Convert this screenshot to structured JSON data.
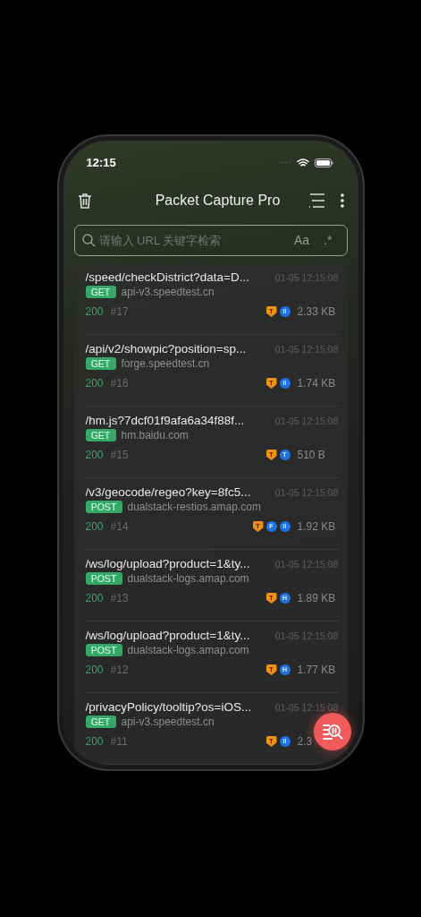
{
  "status_bar": {
    "time": "12:15"
  },
  "header": {
    "title": "Packet Capture Pro"
  },
  "search": {
    "placeholder": "请输入 URL 关键字检索",
    "case_toggle": "Aa",
    "regex_toggle": ".*"
  },
  "requests": [
    {
      "path": "/speed/checkDistrict?data=D...",
      "time": "01-05 12:15:08",
      "method": "GET",
      "host": "api-v3.speedtest.cn",
      "status": "200",
      "index": "#17",
      "tags": [
        {
          "kind": "shield",
          "label": "T"
        },
        {
          "kind": "circle",
          "label": "II"
        }
      ],
      "size": "2.33 KB"
    },
    {
      "path": "/api/v2/showpic?position=sp...",
      "time": "01-05 12:15:08",
      "method": "GET",
      "host": "forge.speedtest.cn",
      "status": "200",
      "index": "#16",
      "tags": [
        {
          "kind": "shield",
          "label": "T"
        },
        {
          "kind": "circle",
          "label": "II"
        }
      ],
      "size": "1.74 KB"
    },
    {
      "path": "/hm.js?7dcf01f9afa6a34f88f...",
      "time": "01-05 12:15:08",
      "method": "GET",
      "host": "hm.baidu.com",
      "status": "200",
      "index": "#15",
      "tags": [
        {
          "kind": "shield",
          "label": "T"
        },
        {
          "kind": "circle",
          "label": "T"
        }
      ],
      "size": "510 B"
    },
    {
      "path": "/v3/geocode/regeo?key=8fc5...",
      "time": "01-05 12:15:08",
      "method": "POST",
      "host": "dualstack-restios.amap.com",
      "status": "200",
      "index": "#14",
      "tags": [
        {
          "kind": "shield",
          "label": "T"
        },
        {
          "kind": "circle",
          "label": "F"
        },
        {
          "kind": "circle",
          "label": "II"
        }
      ],
      "size": "1.92 KB"
    },
    {
      "path": "/ws/log/upload?product=1&ty...",
      "time": "01-05 12:15:08",
      "method": "POST",
      "host": "dualstack-logs.amap.com",
      "status": "200",
      "index": "#13",
      "tags": [
        {
          "kind": "shield",
          "label": "T"
        },
        {
          "kind": "circle",
          "label": "H"
        }
      ],
      "size": "1.89 KB"
    },
    {
      "path": "/ws/log/upload?product=1&ty...",
      "time": "01-05 12:15:08",
      "method": "POST",
      "host": "dualstack-logs.amap.com",
      "status": "200",
      "index": "#12",
      "tags": [
        {
          "kind": "shield",
          "label": "T"
        },
        {
          "kind": "circle",
          "label": "H"
        }
      ],
      "size": "1.77 KB"
    },
    {
      "path": "/privacyPolicy/tooltip?os=iOS...",
      "time": "01-05 12:15:08",
      "method": "GET",
      "host": "api-v3.speedtest.cn",
      "status": "200",
      "index": "#11",
      "tags": [
        {
          "kind": "shield",
          "label": "T"
        },
        {
          "kind": "circle",
          "label": "II"
        }
      ],
      "size": "2.3"
    }
  ]
}
